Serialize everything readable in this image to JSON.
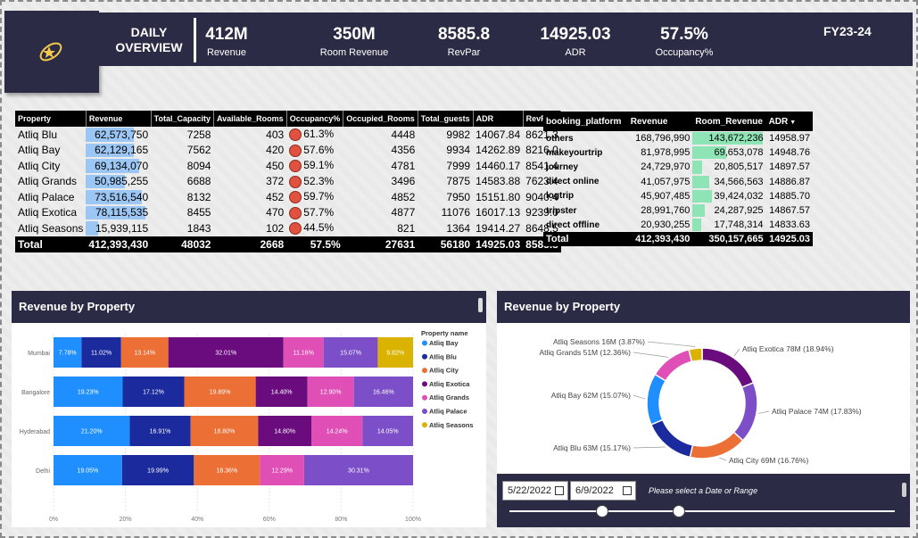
{
  "header": {
    "title_line1": "DAILY",
    "title_line2": "OVERVIEW",
    "fiscal_year": "FY23-24",
    "kpis": [
      {
        "value": "412M",
        "label": "Revenue"
      },
      {
        "value": "350M",
        "label": "Room Revenue"
      },
      {
        "value": "8585.8",
        "label": "RevPar"
      },
      {
        "value": "14925.03",
        "label": "ADR"
      },
      {
        "value": "57.5%",
        "label": "Occupancy%"
      }
    ]
  },
  "property_table": {
    "columns": [
      "Property",
      "Revenue",
      "Total_Capacity",
      "Available_Rooms",
      "Occupancy%",
      "Occupied_Rooms",
      "Total_guests",
      "ADR",
      "RevPar"
    ],
    "rows": [
      {
        "name": "Atliq Blu",
        "revenue": "62,573,750",
        "rev_frac": 0.8,
        "capacity": "7258",
        "available": "403",
        "occupancy": "61.3%",
        "occupied": "4448",
        "guests": "9982",
        "adr": "14067.84",
        "revpar": "8621.3"
      },
      {
        "name": "Atliq Bay",
        "revenue": "62,129,165",
        "rev_frac": 0.8,
        "capacity": "7562",
        "available": "420",
        "occupancy": "57.6%",
        "occupied": "4356",
        "guests": "9934",
        "adr": "14262.89",
        "revpar": "8216.0"
      },
      {
        "name": "Atliq City",
        "revenue": "69,134,070",
        "rev_frac": 0.89,
        "capacity": "8094",
        "available": "450",
        "occupancy": "59.1%",
        "occupied": "4781",
        "guests": "7999",
        "adr": "14460.17",
        "revpar": "8541.4"
      },
      {
        "name": "Atliq Grands",
        "revenue": "50,985,255",
        "rev_frac": 0.65,
        "capacity": "6688",
        "available": "372",
        "occupancy": "52.3%",
        "occupied": "3496",
        "guests": "7875",
        "adr": "14583.88",
        "revpar": "7623.4"
      },
      {
        "name": "Atliq Palace",
        "revenue": "73,516,540",
        "rev_frac": 0.94,
        "capacity": "8132",
        "available": "452",
        "occupancy": "59.7%",
        "occupied": "4852",
        "guests": "7950",
        "adr": "15151.80",
        "revpar": "9040.4"
      },
      {
        "name": "Atliq Exotica",
        "revenue": "78,115,535",
        "rev_frac": 1.0,
        "capacity": "8455",
        "available": "470",
        "occupancy": "57.7%",
        "occupied": "4877",
        "guests": "11076",
        "adr": "16017.13",
        "revpar": "9239.0"
      },
      {
        "name": "Atliq Seasons",
        "revenue": "15,939,115",
        "rev_frac": 0.2,
        "capacity": "1843",
        "available": "102",
        "occupancy": "44.5%",
        "occupied": "821",
        "guests": "1364",
        "adr": "19414.27",
        "revpar": "8648.5"
      }
    ],
    "total": {
      "name": "Total",
      "revenue": "412,393,430",
      "capacity": "48032",
      "available": "2668",
      "occupancy": "57.5%",
      "occupied": "27631",
      "guests": "56180",
      "adr": "14925.03",
      "revpar": "8585.8"
    }
  },
  "platform_table": {
    "columns": [
      "booking_platform",
      "Revenue",
      "Room_Revenue",
      "ADR"
    ],
    "rows": [
      {
        "name": "others",
        "revenue": "168,796,990",
        "room_revenue": "143,672,236",
        "rr_frac": 1.0,
        "adr": "14958.97"
      },
      {
        "name": "makeyourtrip",
        "revenue": "81,978,995",
        "room_revenue": "69,653,078",
        "rr_frac": 0.48,
        "adr": "14948.76"
      },
      {
        "name": "journey",
        "revenue": "24,729,970",
        "room_revenue": "20,805,517",
        "rr_frac": 0.14,
        "adr": "14897.57"
      },
      {
        "name": "direct online",
        "revenue": "41,057,975",
        "room_revenue": "34,566,563",
        "rr_frac": 0.24,
        "adr": "14886.87"
      },
      {
        "name": "logtrip",
        "revenue": "45,907,485",
        "room_revenue": "39,424,032",
        "rr_frac": 0.27,
        "adr": "14885.70"
      },
      {
        "name": "tripster",
        "revenue": "28,991,760",
        "room_revenue": "24,287,925",
        "rr_frac": 0.17,
        "adr": "14867.57"
      },
      {
        "name": "direct offline",
        "revenue": "20,930,255",
        "room_revenue": "17,748,314",
        "rr_frac": 0.12,
        "adr": "14833.63"
      }
    ],
    "total": {
      "name": "Total",
      "revenue": "412,393,430",
      "room_revenue": "350,157,665",
      "adr": "14925.03"
    }
  },
  "colors": {
    "Atliq Bay": "#1f8fff",
    "Atliq Blu": "#1b2a9c",
    "Atliq City": "#ec6f35",
    "Atliq Exotica": "#6b0c7e",
    "Atliq Grands": "#e04fb5",
    "Atliq Palace": "#7c4fc8",
    "Atliq Seasons": "#d9b300"
  },
  "date_filter": {
    "start": "5/22/2022",
    "end": "6/9/2022",
    "hint": "Please select a Date or Range",
    "start_pos": 0.24,
    "end pos_note": "",
    "end_pos": 0.44
  },
  "chart_data": [
    {
      "type": "bar",
      "orientation": "horizontal-stacked-100",
      "title": "Revenue by Property",
      "legend_title": "Property name",
      "legend_position": "right",
      "categories": [
        "Mumbai",
        "Bangalore",
        "Hyderabad",
        "Delhi"
      ],
      "x_ticks": [
        "0%",
        "20%",
        "40%",
        "60%",
        "80%",
        "100%"
      ],
      "series": [
        {
          "name": "Atliq Bay",
          "values": [
            7.78,
            19.23,
            21.2,
            19.05
          ]
        },
        {
          "name": "Atliq Blu",
          "values": [
            11.02,
            17.12,
            16.91,
            19.99
          ]
        },
        {
          "name": "Atliq City",
          "values": [
            13.14,
            19.89,
            18.8,
            18.36
          ]
        },
        {
          "name": "Atliq Exotica",
          "values": [
            32.01,
            14.4,
            14.8,
            0
          ]
        },
        {
          "name": "Atliq Grands",
          "values": [
            11.16,
            12.9,
            14.24,
            12.29
          ]
        },
        {
          "name": "Atliq Palace",
          "values": [
            15.07,
            16.46,
            14.05,
            30.31
          ]
        },
        {
          "name": "Atliq Seasons",
          "values": [
            9.82,
            0,
            0,
            0
          ]
        }
      ],
      "labels": [
        [
          "7.78%",
          "11.02%",
          "13.14%",
          "32.01%",
          "11.16%",
          "15.07%",
          "9.82%"
        ],
        [
          "19.23%",
          "17.12%",
          "19.89%",
          "14.40%",
          "12.90%",
          "16.46%",
          ""
        ],
        [
          "21.20%",
          "16.91%",
          "18.80%",
          "14.80%",
          "14.24%",
          "14.05%",
          ""
        ],
        [
          "19.05%",
          "19.99%",
          "18.36%",
          "",
          "12.29%",
          "30.31%",
          ""
        ]
      ]
    },
    {
      "type": "pie",
      "variant": "donut",
      "title": "Revenue by Property",
      "slices": [
        {
          "name": "Atliq Exotica",
          "value": 18.94,
          "label": "Atliq Exotica 78M (18.94%)"
        },
        {
          "name": "Atliq Palace",
          "value": 17.83,
          "label": "Atliq Palace 74M (17.83%)"
        },
        {
          "name": "Atliq City",
          "value": 16.76,
          "label": "Atliq City 69M (16.76%)"
        },
        {
          "name": "Atliq Blu",
          "value": 15.17,
          "label": "Atliq Blu 63M (15.17%)"
        },
        {
          "name": "Atliq Bay",
          "value": 15.07,
          "label": "Atliq Bay 62M (15.07%)"
        },
        {
          "name": "Atliq Grands",
          "value": 12.36,
          "label": "Atliq Grands 51M (12.36%)"
        },
        {
          "name": "Atliq Seasons",
          "value": 3.87,
          "label": "Atliq Seasons 16M (3.87%)"
        }
      ]
    }
  ]
}
